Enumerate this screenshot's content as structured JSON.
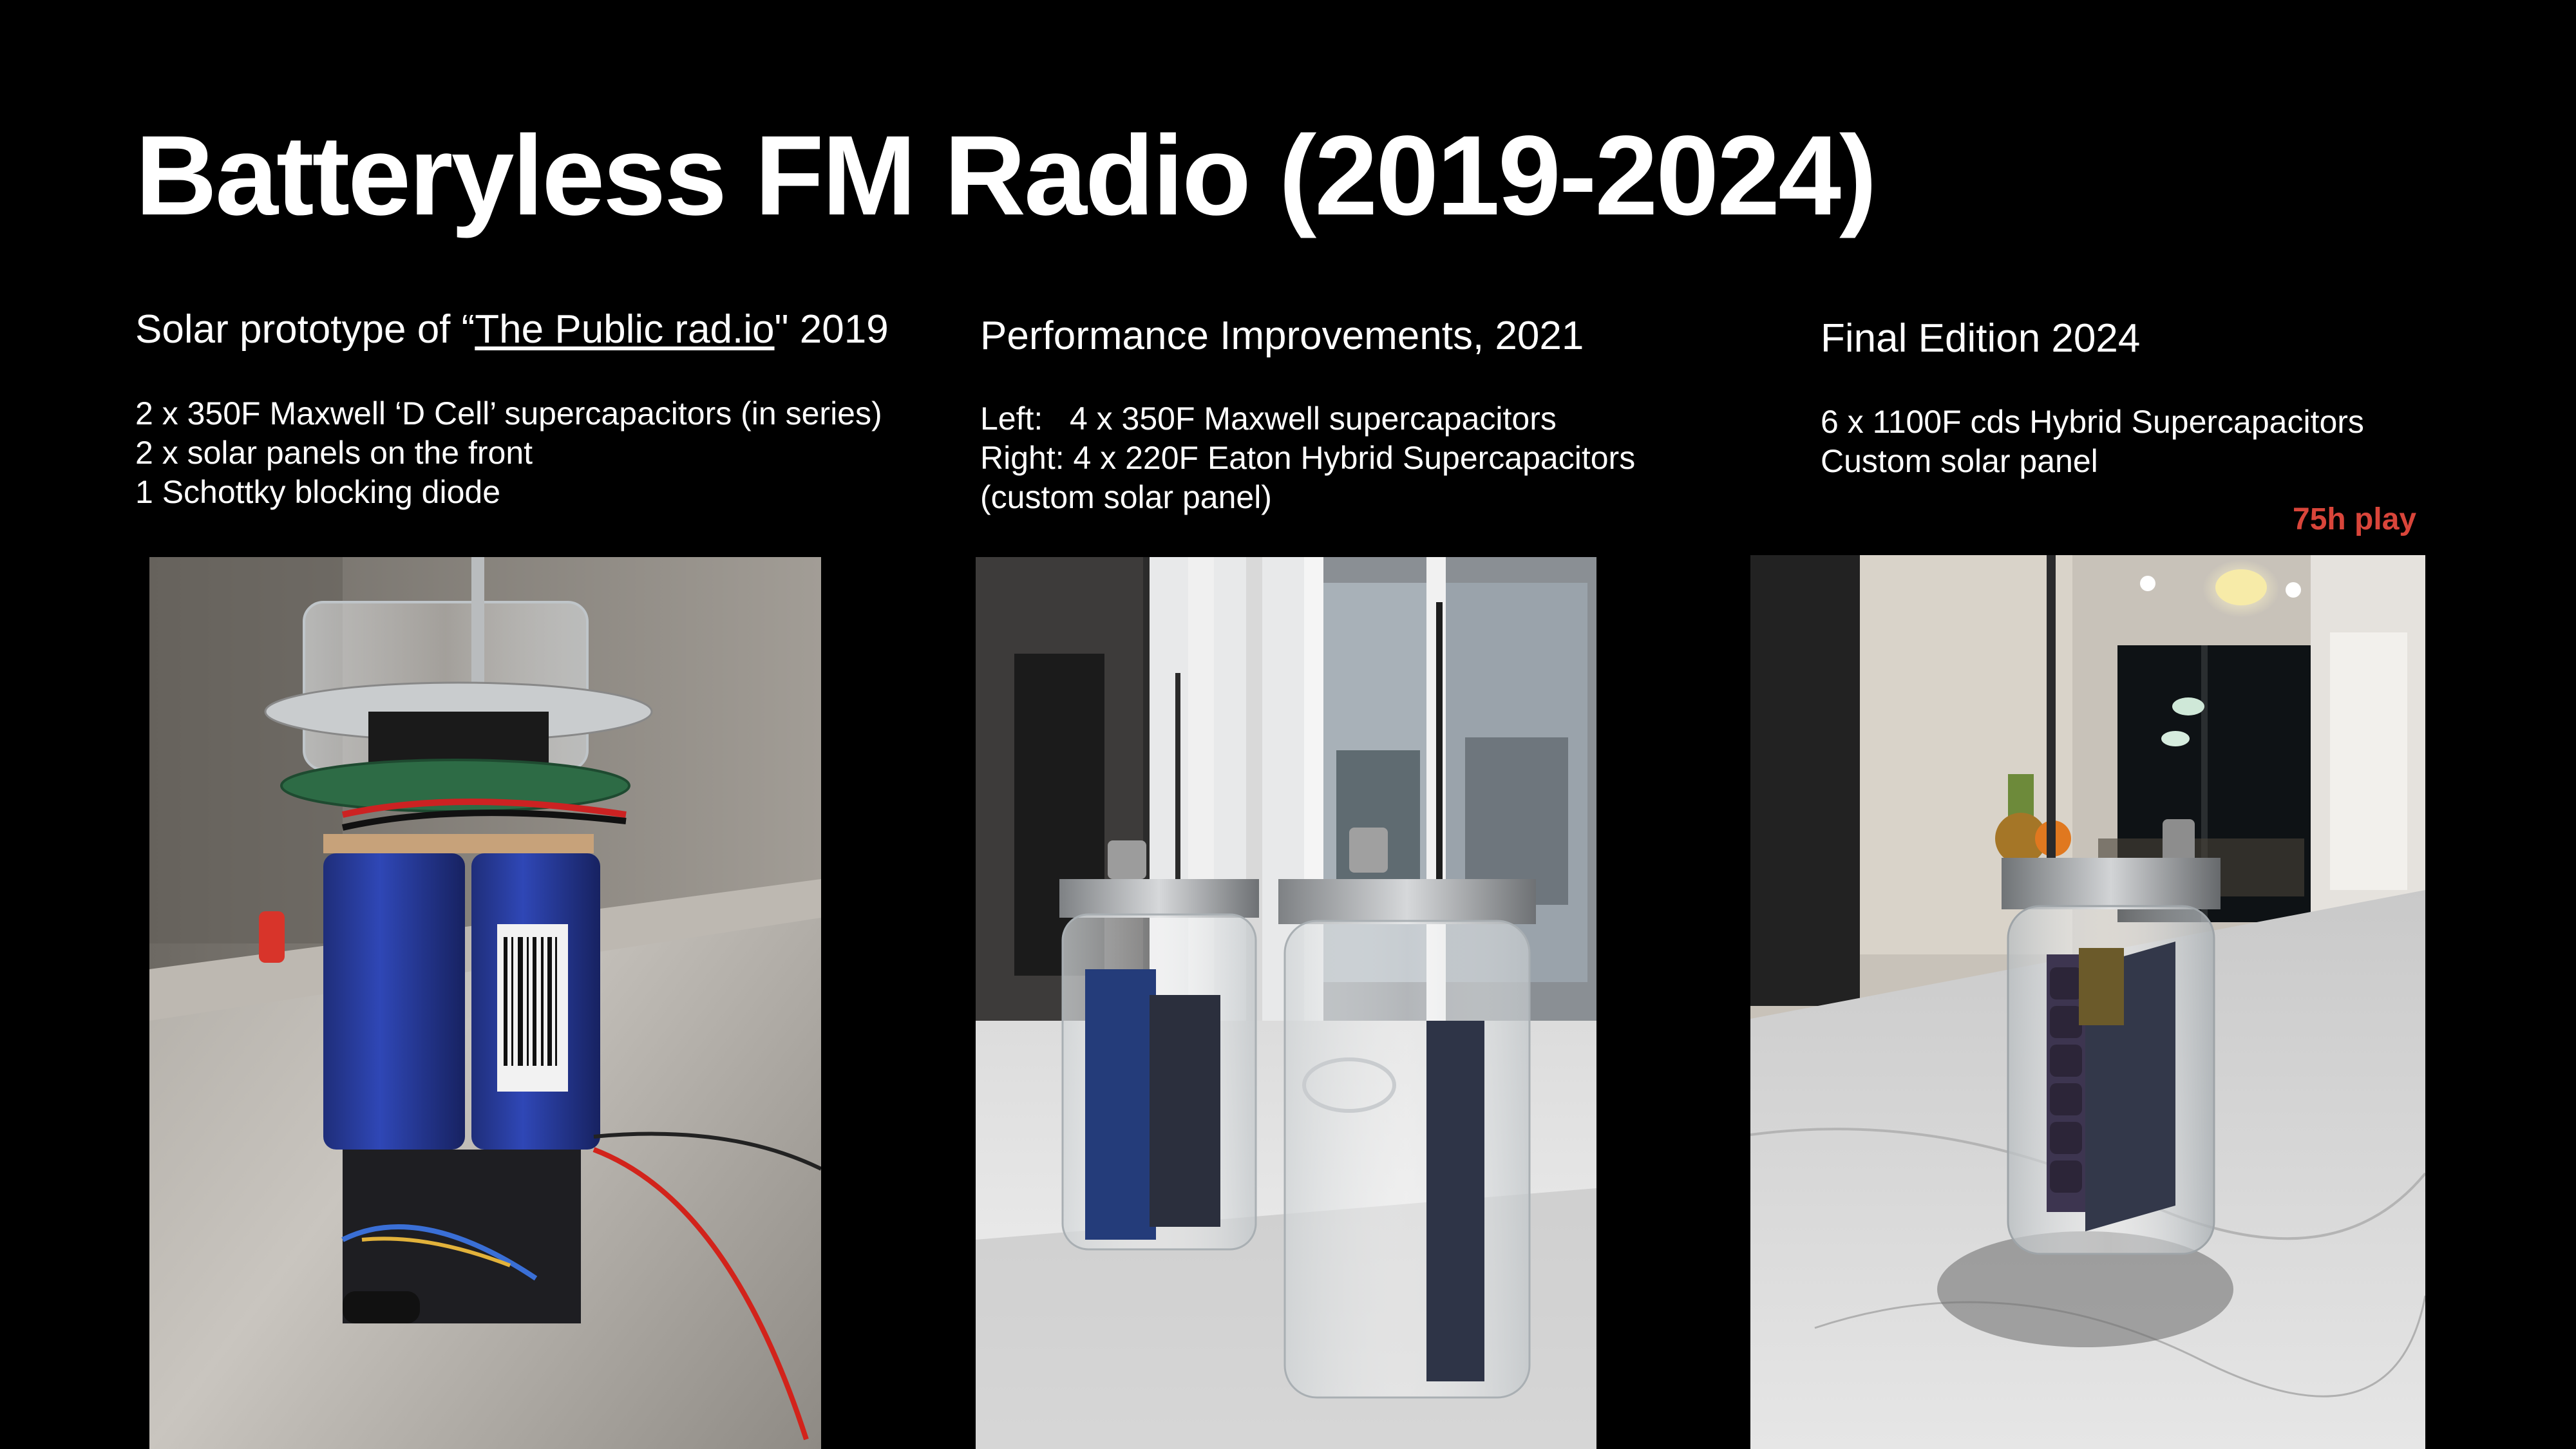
{
  "slide": {
    "title": "Batteryless FM Radio (2019-2024)"
  },
  "columns": [
    {
      "heading_prefix": "Solar prototype of “",
      "heading_link": "The Public rad.io",
      "heading_suffix": "\" 2019",
      "lines": [
        "2 x 350F Maxwell ‘D Cell’ supercapacitors (in series)",
        "2 x solar panels on the front",
        "1 Schottky blocking diode"
      ]
    },
    {
      "heading": "Performance Improvements, 2021",
      "lines": [
        "Left:   4 x 350F Maxwell supercapacitors",
        "Right: 4 x 220F Eaton Hybrid Supercapacitors",
        "(custom solar panel)"
      ]
    },
    {
      "heading": "Final Edition 2024",
      "lines": [
        "6 x 1100F cds Hybrid Supercapacitors",
        "Custom solar panel"
      ],
      "badge": "75h play"
    }
  ],
  "colors": {
    "background": "#000000",
    "text": "#ffffff",
    "badge": "#d9453a"
  }
}
